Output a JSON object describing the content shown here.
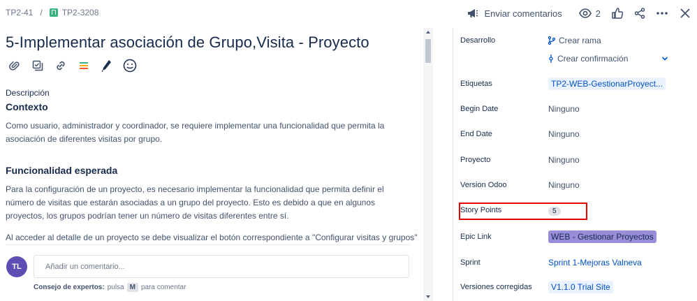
{
  "breadcrumb": {
    "parent": "TP2-41",
    "separator": "/",
    "current": "TP2-3208"
  },
  "header_actions": {
    "feedback_label": "Enviar comentarios",
    "watchers_count": "2"
  },
  "issue": {
    "title": "5-Implementar asociación de Grupo,Visita - Proyecto",
    "description_label": "Descripción",
    "section1_heading": "Contexto",
    "section1_text": "Como usuario, administrador y coordinador, se requiere implementar una funcionalidad que permita la asociación de diferentes visitas por grupo.",
    "section2_heading": "Funcionalidad esperada",
    "section2_text": "Para la configuración de un proyecto, es necesario implementar la funcionalidad que permita definir el número de visitas que estarán asociadas a un grupo del proyecto. Esto es debido a que en algunos proyectos, los grupos podrían tener un número de visitas diferentes entre sí.",
    "section2_text2": "Al acceder al detalle de un proyecto se debe visualizar el botón correspondiente a \"Configurar visitas y grupos\""
  },
  "comment": {
    "avatar_initials": "TL",
    "placeholder": "Añadir un comentario...",
    "tip_bold": "Consejo de expertos:",
    "tip_text1": "pulsa",
    "tip_key": "M",
    "tip_text2": "para comentar"
  },
  "details": {
    "development": {
      "label": "Desarrollo",
      "create_branch": "Crear rama",
      "create_commit": "Crear confirmación"
    },
    "labels": {
      "label": "Etiquetas",
      "value": "TP2-WEB-GestionarProyect..."
    },
    "begin_date": {
      "label": "Begin Date",
      "value": "Ninguno"
    },
    "end_date": {
      "label": "End Date",
      "value": "Ninguno"
    },
    "project": {
      "label": "Proyecto",
      "value": "Ninguno"
    },
    "version_odoo": {
      "label": "Version Odoo",
      "value": "Ninguno"
    },
    "story_points": {
      "label": "Story Points",
      "value": "5"
    },
    "epic_link": {
      "label": "Epic Link",
      "value": "WEB - Gestionar Proyectos"
    },
    "sprint": {
      "label": "Sprint",
      "value": "Sprint 1-Mejoras Valneva"
    },
    "fix_versions": {
      "label": "Versiones corregidas",
      "value": "V1.1.0 Trial Site"
    }
  },
  "colors": {
    "link": "#0052cc",
    "epic": "#998dd9",
    "highlight": "#e60000",
    "avatar": "#5e4db2"
  }
}
